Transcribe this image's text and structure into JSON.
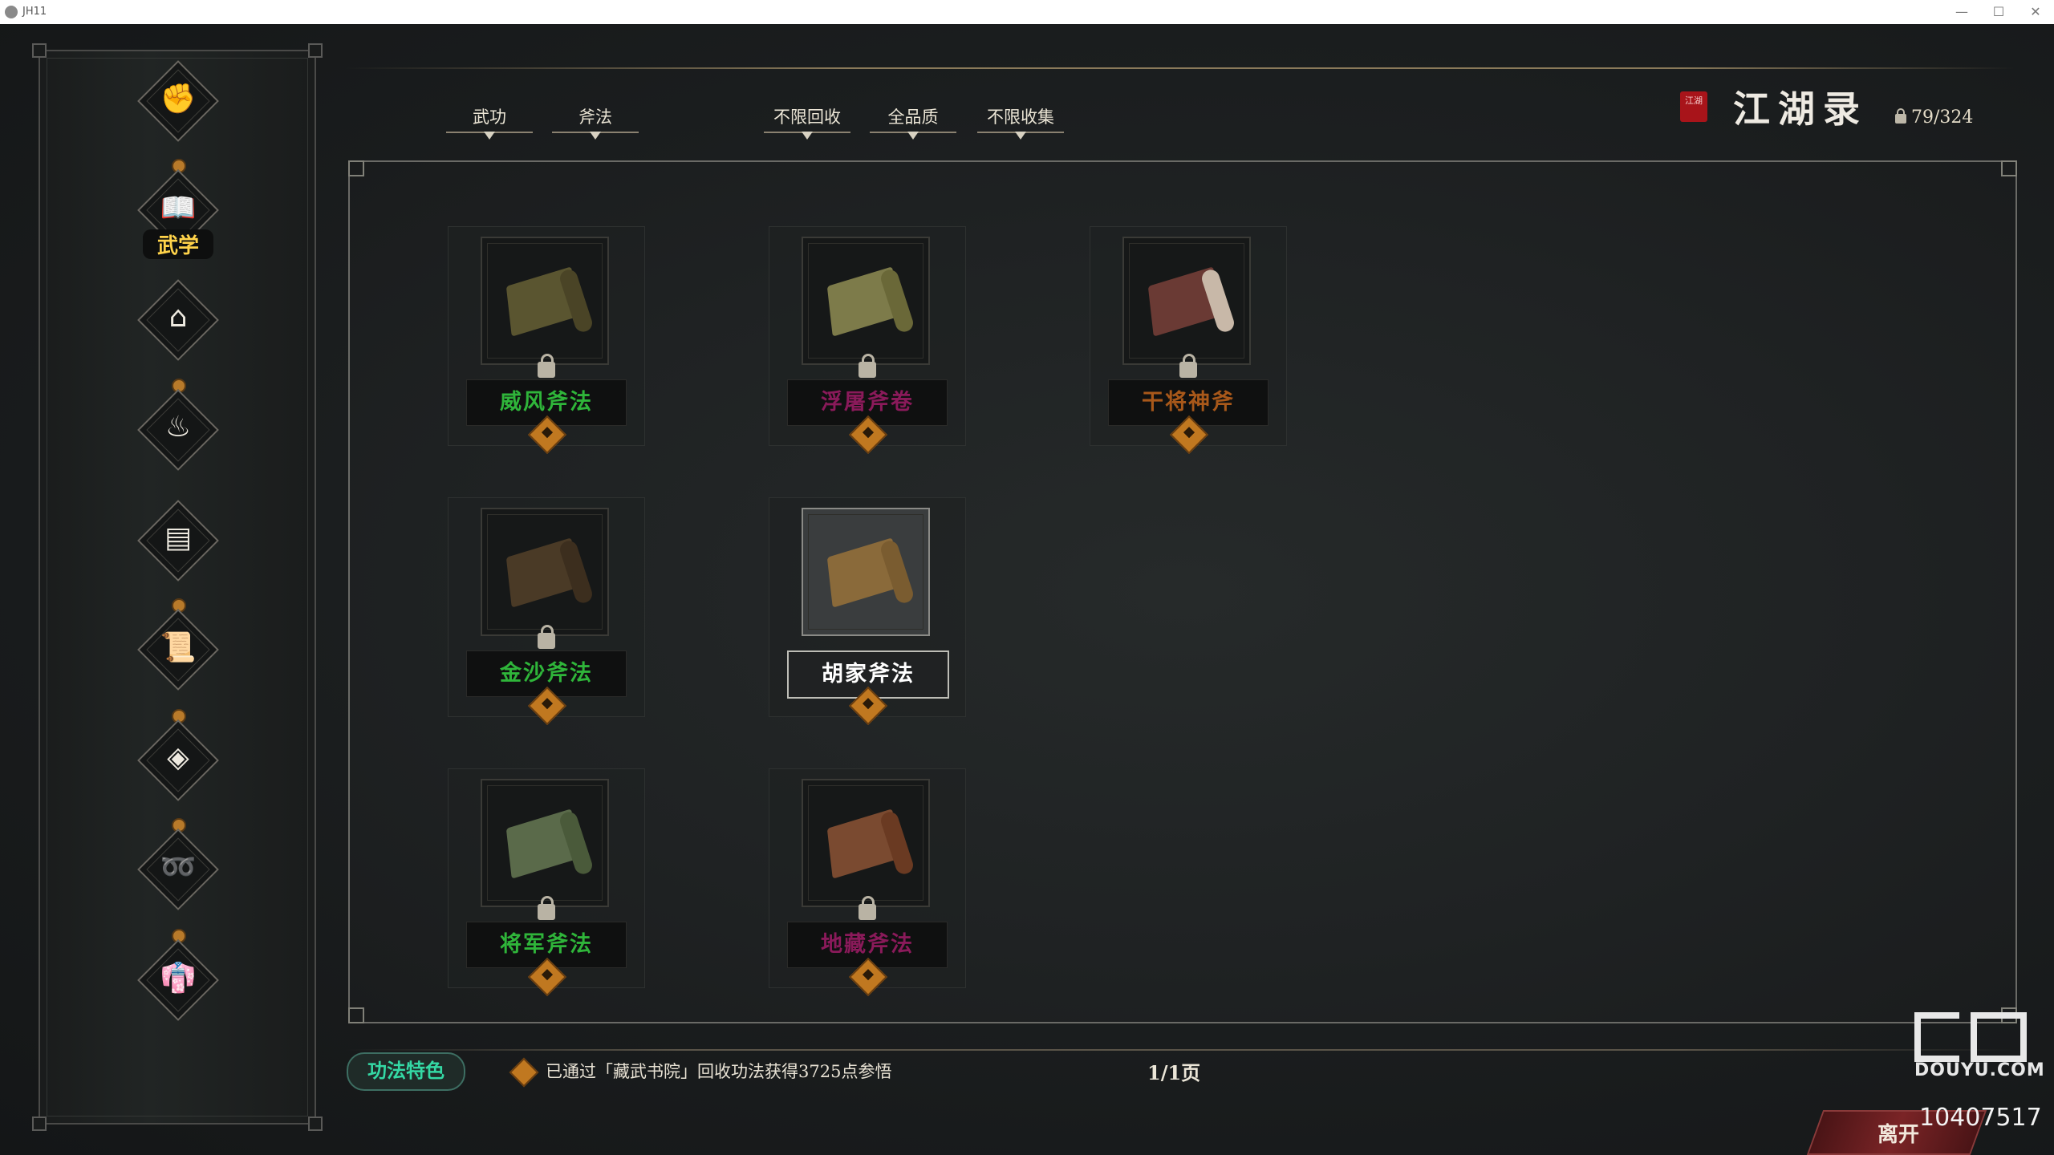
{
  "window": {
    "title": "JH11",
    "minimize": "—",
    "maximize": "☐",
    "close": "✕"
  },
  "sidebar": {
    "items": [
      {
        "icon": "fist-icon",
        "glyph": "✊",
        "label": "",
        "knob": false
      },
      {
        "icon": "book-icon",
        "glyph": "📖",
        "label": "武学",
        "knob": true,
        "selected": true
      },
      {
        "icon": "house-icon",
        "glyph": "⌂",
        "label": "",
        "knob": false
      },
      {
        "icon": "dish-icon",
        "glyph": "♨",
        "label": "",
        "knob": true
      },
      {
        "icon": "map-icon",
        "glyph": "▤",
        "label": "",
        "knob": false
      },
      {
        "icon": "scroll-icon",
        "glyph": "📜",
        "label": "",
        "knob": true
      },
      {
        "icon": "box-icon",
        "glyph": "◈",
        "label": "",
        "knob": true
      },
      {
        "icon": "rope-icon",
        "glyph": "➿",
        "label": "",
        "knob": true
      },
      {
        "icon": "robe-icon",
        "glyph": "👘",
        "label": "",
        "knob": true
      }
    ]
  },
  "tabs": [
    {
      "label": "武功"
    },
    {
      "label": "斧法"
    },
    {
      "label": "不限回收"
    },
    {
      "label": "全品质"
    },
    {
      "label": "不限收集"
    }
  ],
  "header": {
    "seal_text": "江湖",
    "title": "江湖录",
    "count": "79/324"
  },
  "cards": [
    {
      "name": "威风斧法",
      "name_color": "#2fb53a",
      "paper": "#5a5530",
      "roll": "#4a4426",
      "locked": true,
      "selected": false
    },
    {
      "name": "浮屠斧卷",
      "name_color": "#8a1a5a",
      "paper": "#7d7b4a",
      "roll": "#6a6838",
      "locked": true,
      "selected": false
    },
    {
      "name": "干将神斧",
      "name_color": "#a8581a",
      "paper": "#6a3a34",
      "roll": "#c8b8a8",
      "locked": true,
      "selected": false
    },
    {
      "name": "金沙斧法",
      "name_color": "#2fb53a",
      "paper": "#4a3a26",
      "roll": "#3c2e1e",
      "locked": true,
      "selected": false
    },
    {
      "name": "胡家斧法",
      "name_color": "#ffffff",
      "paper": "#8a6a3a",
      "roll": "#7a5c30",
      "locked": false,
      "selected": true
    },
    {
      "name": "将军斧法",
      "name_color": "#2fb53a",
      "paper": "#5a6a4a",
      "roll": "#4a5a3a",
      "locked": true,
      "selected": false
    },
    {
      "name": "地藏斧法",
      "name_color": "#8a1a5a",
      "paper": "#7a4a30",
      "roll": "#6a3a22",
      "locked": true,
      "selected": false
    }
  ],
  "bottom": {
    "feature_label": "功法特色",
    "info": "已通过「藏武书院」回收功法获得3725点参悟",
    "page": "1/1页",
    "exit_label": "离开"
  },
  "watermark": {
    "brand": "DOUYU.COM",
    "room_id": "10407517"
  }
}
